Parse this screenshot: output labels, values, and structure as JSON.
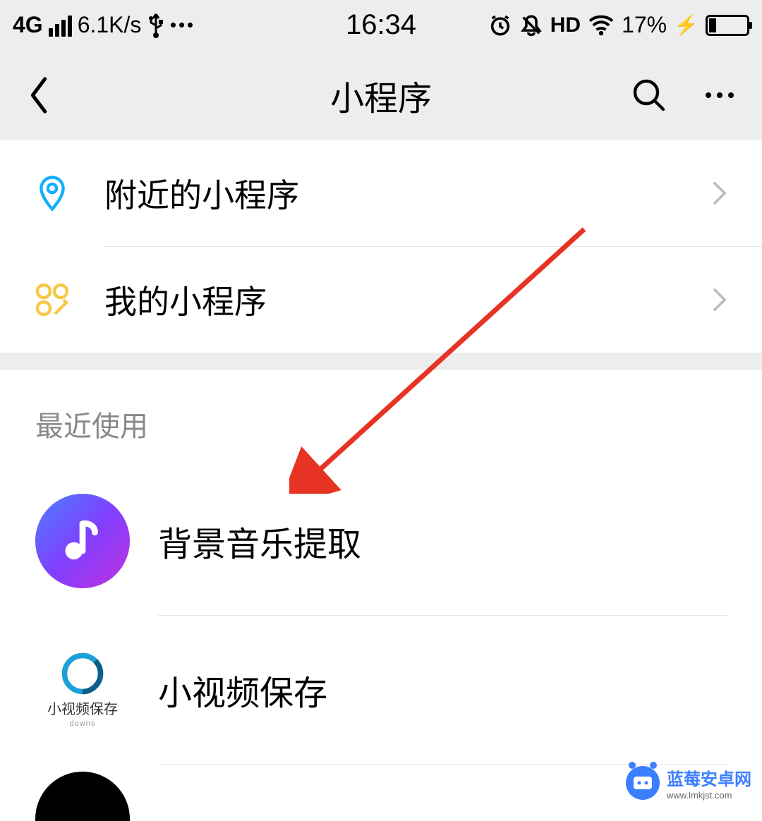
{
  "statusBar": {
    "network": "4G",
    "speed": "6.1K/s",
    "time": "16:34",
    "hd": "HD",
    "battery": "17%"
  },
  "header": {
    "title": "小程序"
  },
  "section1": {
    "items": [
      {
        "label": "附近的小程序"
      },
      {
        "label": "我的小程序"
      }
    ]
  },
  "section2": {
    "header": "最近使用",
    "apps": [
      {
        "label": "背景音乐提取"
      },
      {
        "label": "小视频保存",
        "iconText": "小视频保存",
        "iconSubtext": "downs"
      }
    ]
  },
  "watermark": {
    "title": "蓝莓安卓网",
    "url": "www.lmkjst.com"
  }
}
